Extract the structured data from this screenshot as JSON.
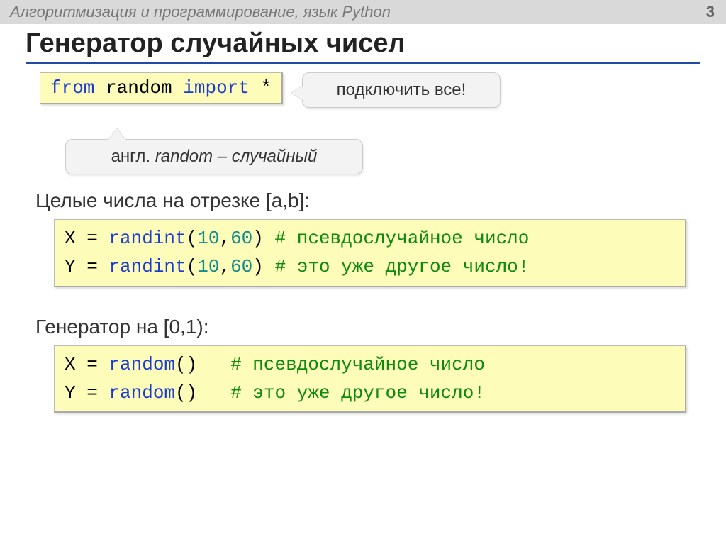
{
  "header": {
    "topic": "Алгоритмизация и программирование, язык Python",
    "page": "3"
  },
  "title": "Генератор случайных чисел",
  "import_code": {
    "kw_from": "from",
    "mod": "random",
    "kw_import": "import",
    "star": "*"
  },
  "annot_right": "подключить все!",
  "annot_below_prefix": "англ. ",
  "annot_below_italic": "random – случайный",
  "sections": {
    "int": {
      "heading": "Целые числа на отрезке [a,b]:",
      "lines": [
        {
          "var": "X",
          "fn": "randint",
          "args_open": "(",
          "a1": "10",
          "comma": ",",
          "a2": "60",
          "args_close": ")",
          "comment": "# псевдослучайное число"
        },
        {
          "var": "Y",
          "fn": "randint",
          "args_open": "(",
          "a1": "10",
          "comma": ",",
          "a2": "60",
          "args_close": ")",
          "comment": "# это уже другое число!"
        }
      ]
    },
    "float": {
      "heading": "Генератор на [0,1):",
      "lines": [
        {
          "var": "X",
          "fn": "random",
          "call": "()",
          "pad": "   ",
          "comment": "# псевдослучайное число"
        },
        {
          "var": "Y",
          "fn": "random",
          "call": "()",
          "pad": "   ",
          "comment": "# это уже другое число!"
        }
      ]
    }
  }
}
